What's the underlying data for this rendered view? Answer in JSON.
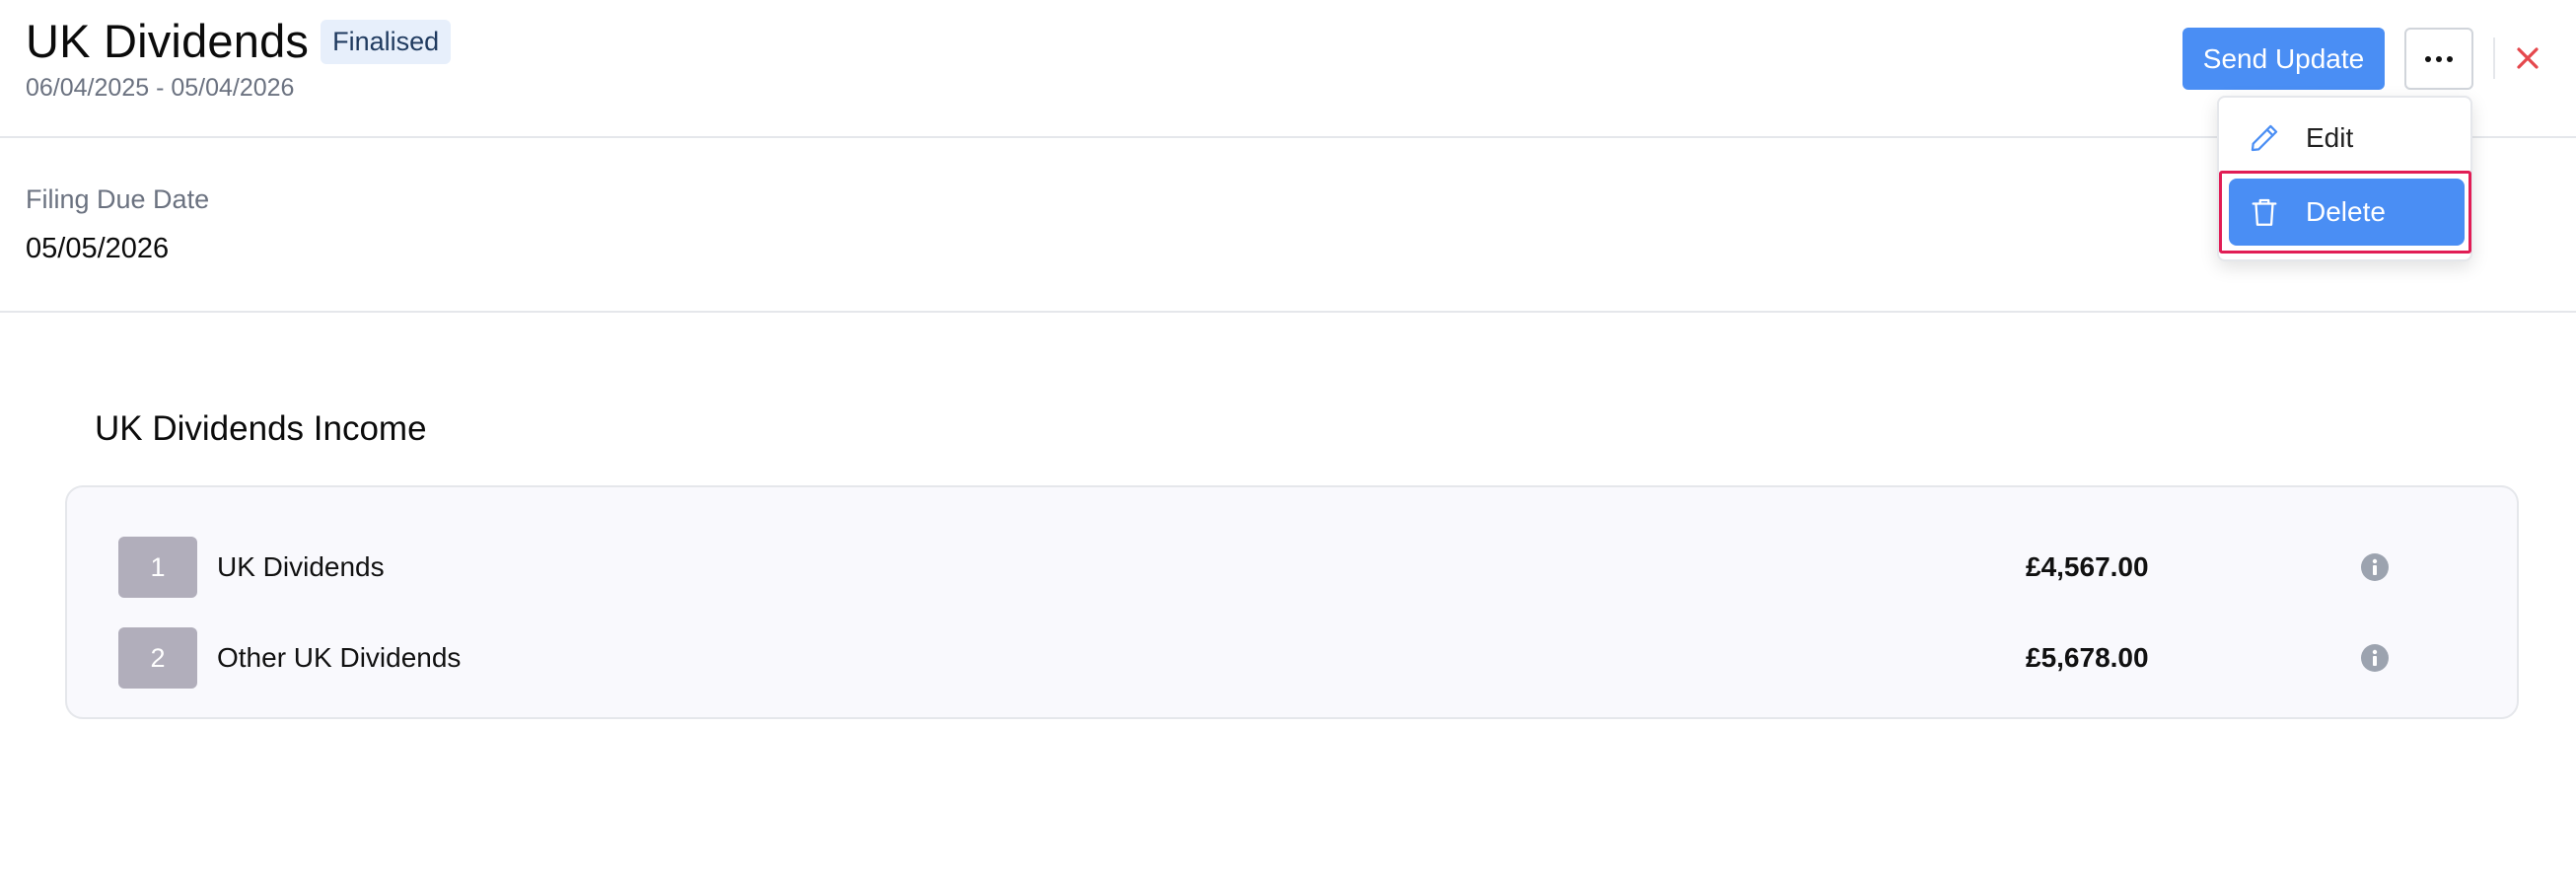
{
  "header": {
    "title": "UK Dividends",
    "status": "Finalised",
    "date_range": "06/04/2025 - 05/04/2026",
    "send_update_label": "Send Update",
    "more_icon": "more-horizontal-icon",
    "close_icon": "close-icon"
  },
  "filing": {
    "label": "Filing Due Date",
    "value": "05/05/2026"
  },
  "income": {
    "title": "UK Dividends Income",
    "rows": [
      {
        "num": "1",
        "label": "UK Dividends",
        "amount": "£4,567.00"
      },
      {
        "num": "2",
        "label": "Other UK Dividends",
        "amount": "£5,678.00"
      }
    ],
    "info_icon": "info-icon"
  },
  "menu": {
    "items": [
      {
        "label": "Edit",
        "icon": "pencil-icon"
      },
      {
        "label": "Delete",
        "icon": "trash-icon"
      }
    ]
  },
  "colors": {
    "primary": "#4a8ef4",
    "close": "#e5484d",
    "highlight": "#e11d55",
    "badge_bg": "#e7effb",
    "row_number_bg": "#b1aebb"
  }
}
